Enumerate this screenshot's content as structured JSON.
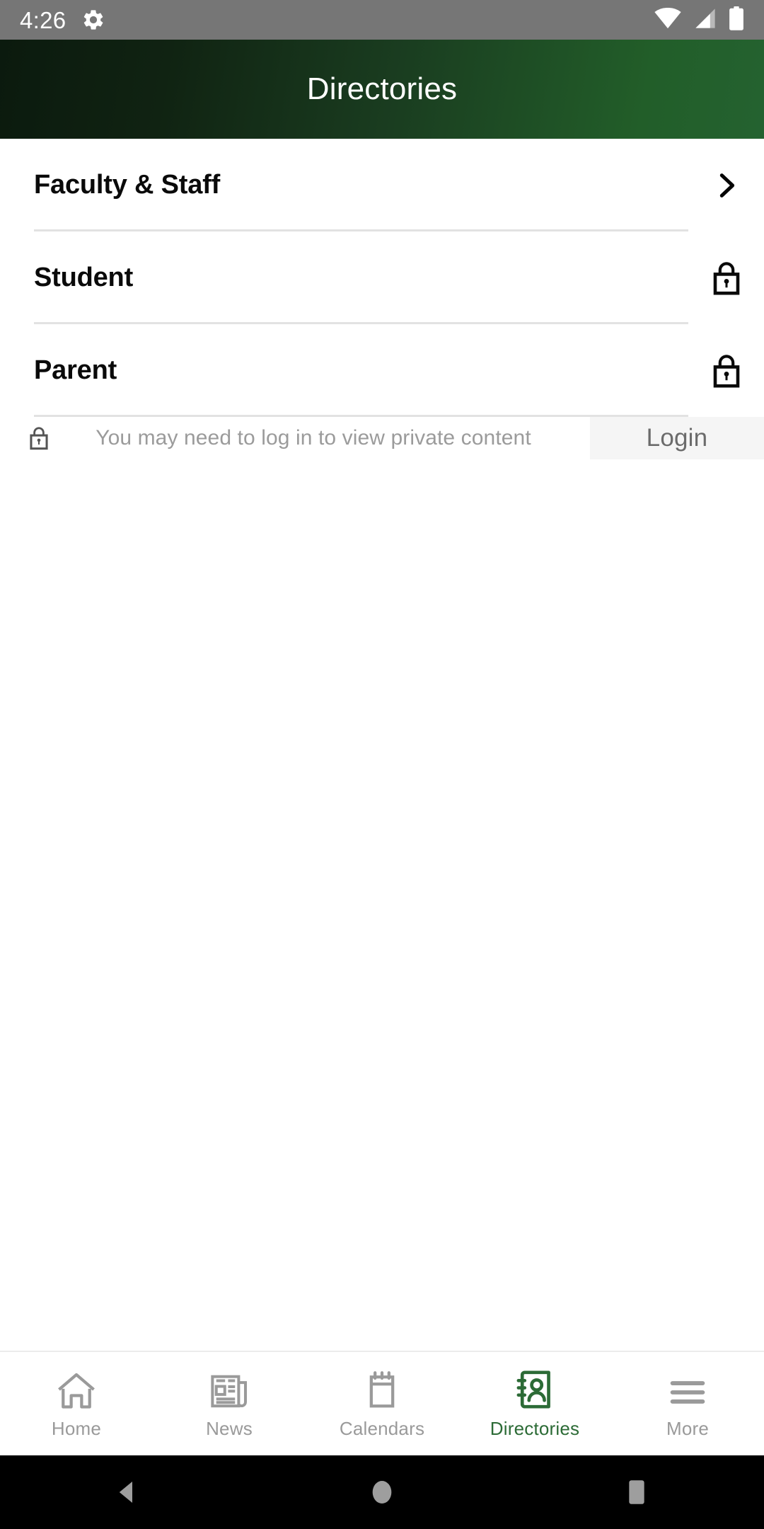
{
  "status_bar": {
    "time": "4:26",
    "icons": [
      "gear-icon",
      "wifi-icon",
      "cellular-signal-icon",
      "battery-icon"
    ]
  },
  "header": {
    "title": "Directories",
    "gradient_start": "#0b1a0e",
    "gradient_end": "#246230"
  },
  "directory_list": [
    {
      "label": "Faculty & Staff",
      "accessory": "chevron-right-icon",
      "locked": false
    },
    {
      "label": "Student",
      "accessory": "lock-icon",
      "locked": true
    },
    {
      "label": "Parent",
      "accessory": "lock-icon",
      "locked": true
    }
  ],
  "notice": {
    "icon": "lock-icon",
    "message": "You may need to log in to view private content",
    "login_label": "Login",
    "login_bg": "#f5f5f5"
  },
  "tab_bar": {
    "active_color": "#2c6b36",
    "inactive_color": "#9a9a9a",
    "tabs": [
      {
        "label": "Home",
        "icon": "home-icon",
        "active": false
      },
      {
        "label": "News",
        "icon": "newspaper-icon",
        "active": false
      },
      {
        "label": "Calendars",
        "icon": "calendar-icon",
        "active": false
      },
      {
        "label": "Directories",
        "icon": "contact-book-icon",
        "active": true
      },
      {
        "label": "More",
        "icon": "hamburger-menu-icon",
        "active": false
      }
    ]
  },
  "system_nav": {
    "back": "back-triangle-icon",
    "home": "home-circle-icon",
    "recents": "recents-square-icon"
  }
}
